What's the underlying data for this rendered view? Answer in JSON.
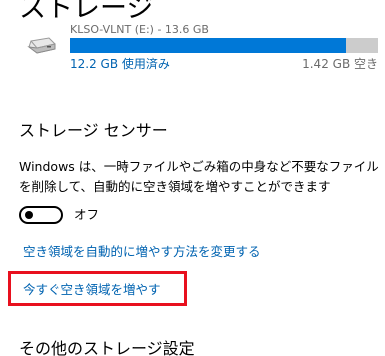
{
  "page": {
    "title": "ストレージ"
  },
  "drive": {
    "name": "KLSO-VLNT (E:) - 13.6 GB",
    "icon": "drive-icon",
    "used_fraction": 0.896,
    "used_label": "12.2 GB 使用済み",
    "free_label": "1.42 GB 空き",
    "colors": {
      "used": "#0078d7",
      "free": "#cccccc"
    }
  },
  "storage_sense": {
    "heading": "ストレージ センサー",
    "description": "Windows は、一時ファイルやごみ箱の中身など不要なファイルを削除して、自動的に空き領域を増やすことができます",
    "toggle": {
      "state": "off",
      "label": "オフ"
    },
    "change_link": "空き領域を自動的に増やす方法を変更する",
    "free_now_link": "今すぐ空き領域を増やす",
    "highlight_color": "#e8101e"
  },
  "other": {
    "heading": "その他のストレージ設定"
  }
}
